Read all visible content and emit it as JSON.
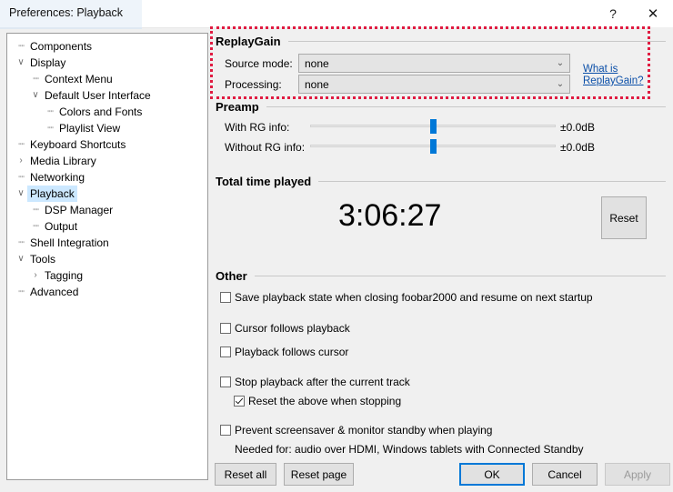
{
  "window": {
    "title": "Preferences: Playback",
    "help_icon": "question-mark-icon",
    "help_glyph": "?",
    "close_icon": "close-icon",
    "close_glyph": "✕"
  },
  "sidebar": {
    "items": [
      {
        "label": "Components",
        "indent": 1,
        "marker": "leaf",
        "selected": false
      },
      {
        "label": "Display",
        "indent": 1,
        "marker": "expanded",
        "selected": false
      },
      {
        "label": "Context Menu",
        "indent": 2,
        "marker": "leaf",
        "selected": false
      },
      {
        "label": "Default User Interface",
        "indent": 2,
        "marker": "expanded",
        "selected": false
      },
      {
        "label": "Colors and Fonts",
        "indent": 3,
        "marker": "leaf",
        "selected": false
      },
      {
        "label": "Playlist View",
        "indent": 3,
        "marker": "leaf",
        "selected": false
      },
      {
        "label": "Keyboard Shortcuts",
        "indent": 1,
        "marker": "leaf",
        "selected": false
      },
      {
        "label": "Media Library",
        "indent": 1,
        "marker": "collapsed",
        "selected": false
      },
      {
        "label": "Networking",
        "indent": 1,
        "marker": "leaf",
        "selected": false
      },
      {
        "label": "Playback",
        "indent": 1,
        "marker": "expanded",
        "selected": true
      },
      {
        "label": "DSP Manager",
        "indent": 2,
        "marker": "leaf",
        "selected": false
      },
      {
        "label": "Output",
        "indent": 2,
        "marker": "leaf",
        "selected": false
      },
      {
        "label": "Shell Integration",
        "indent": 1,
        "marker": "leaf",
        "selected": false
      },
      {
        "label": "Tools",
        "indent": 1,
        "marker": "expanded",
        "selected": false
      },
      {
        "label": "Tagging",
        "indent": 2,
        "marker": "collapsed",
        "selected": false
      },
      {
        "label": "Advanced",
        "indent": 1,
        "marker": "leaf",
        "selected": false
      }
    ]
  },
  "replaygain": {
    "title": "ReplayGain",
    "source_mode_label": "Source mode:",
    "source_mode_value": "none",
    "processing_label": "Processing:",
    "processing_value": "none",
    "link_line1": "What is",
    "link_line2": "ReplayGain?",
    "chevron_glyph": "⌄"
  },
  "preamp": {
    "title": "Preamp",
    "with_rg_label": "With RG info:",
    "with_rg_value": "±0.0dB",
    "without_rg_label": "Without RG info:",
    "without_rg_value": "±0.0dB"
  },
  "total_time": {
    "title": "Total time played",
    "value": "3:06:27",
    "reset_label": "Reset"
  },
  "other": {
    "title": "Other",
    "checkboxes": [
      {
        "label": "Save playback state when closing foobar2000 and resume on next startup",
        "checked": false
      },
      {
        "label": "Cursor follows playback",
        "checked": false
      },
      {
        "label": "Playback follows cursor",
        "checked": false
      },
      {
        "label": "Stop playback after the current track",
        "checked": false
      },
      {
        "label": "Reset the above when stopping",
        "checked": true
      },
      {
        "label": "Prevent screensaver & monitor standby when playing",
        "checked": false
      }
    ],
    "note": "Needed for: audio over HDMI, Windows tablets with Connected Standby"
  },
  "footer": {
    "reset_all": "Reset all",
    "reset_page": "Reset page",
    "ok": "OK",
    "cancel": "Cancel",
    "apply": "Apply"
  },
  "colors": {
    "accent": "#0078d7",
    "selection": "#cce8ff",
    "annotation": "#e01b41",
    "link": "#0b4fa8",
    "window_bg": "#f0f0f0"
  }
}
